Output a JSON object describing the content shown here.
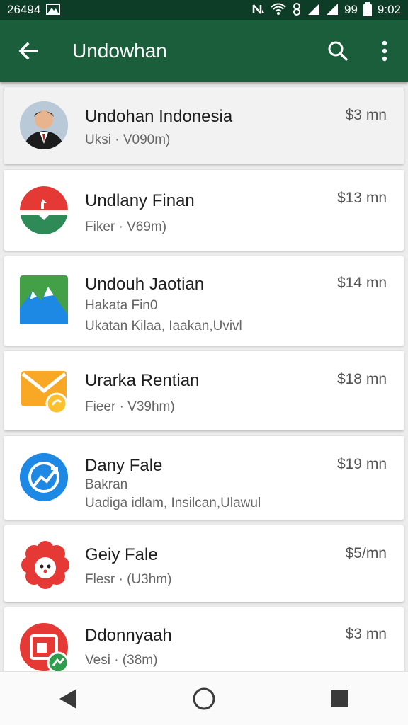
{
  "status_bar": {
    "left_text": "26494",
    "battery": "99",
    "time": "9:02"
  },
  "app_bar": {
    "title": "Undowhan",
    "back_icon": "arrow-back-icon",
    "search_icon": "search-icon",
    "more_icon": "more-vert-icon"
  },
  "items": [
    {
      "name": "Undohan Indonesia",
      "lines": [
        "Uksi · V090m)"
      ],
      "price": "$3 mn",
      "icon": "person-photo"
    },
    {
      "name": "Undlany Finan",
      "lines": [
        "Fiker · V69m)"
      ],
      "price": "$13 mn",
      "icon": "red-green-circle"
    },
    {
      "name": "Undouh Jaotian",
      "lines": [
        "Hakata Fin0",
        "Ukatan Kilaa, Iaakan,Uvivl"
      ],
      "price": "$14 mn",
      "icon": "mountain-icon"
    },
    {
      "name": "Urarka Rentian",
      "lines": [
        "Fieer · V39hm)"
      ],
      "price": "$18 mn",
      "icon": "mail-icon"
    },
    {
      "name": "Dany Fale",
      "lines": [
        "Bakran",
        "Uadiga idlam, Insilcan,Ulawul"
      ],
      "price": "$19 mn",
      "icon": "sync-icon"
    },
    {
      "name": "Geiy Fale",
      "lines": [
        "Flesr · (U3hm)"
      ],
      "price": "$5/mn",
      "icon": "flower-icon"
    },
    {
      "name": "Ddonnyaah",
      "lines": [
        "Vesi · (38m)"
      ],
      "price": "$3 mn",
      "icon": "photo-icon"
    }
  ],
  "colors": {
    "status_bar": "#0d3d26",
    "app_bar": "#1b5e3b"
  }
}
